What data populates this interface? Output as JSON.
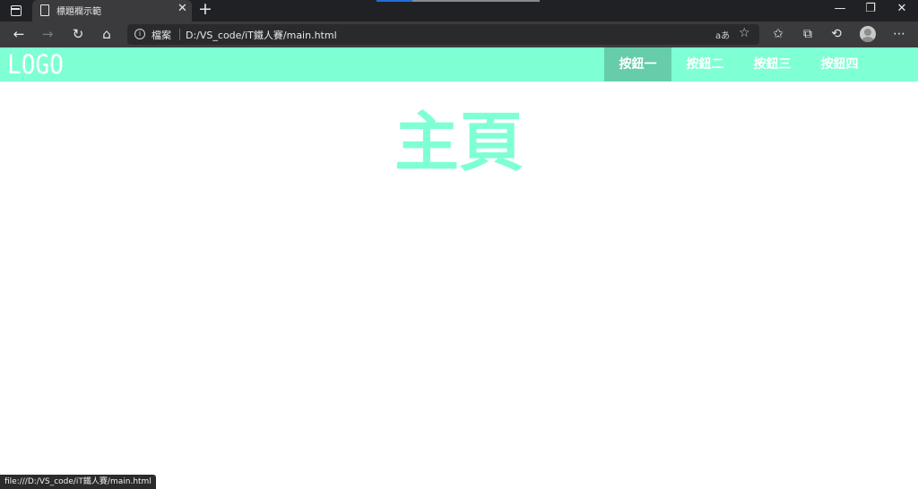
{
  "browser": {
    "tab_title": "標題欄示範",
    "address_label": "檔案",
    "url": "D:/VS_code/iT鐵人賽/main.html",
    "status_url": "file:///D:/VS_code/iT鐵人賽/main.html",
    "icons": {
      "tab_actions": "window-icon",
      "page": "document-icon",
      "close_tab": "close-icon",
      "new_tab": "plus-icon",
      "back": "back-arrow-icon",
      "forward": "forward-arrow-icon",
      "refresh": "refresh-icon",
      "home": "home-icon",
      "site_info": "info-icon",
      "read_aloud": "read-aloud-icon",
      "add_favorite": "add-favorite-icon",
      "favorites": "favorites-icon",
      "collections": "collections-icon",
      "history": "history-icon",
      "profile": "profile-avatar",
      "more": "more-icon"
    }
  },
  "page": {
    "logo": "LOGO",
    "nav_items": [
      {
        "label": "按鈕一",
        "active": true
      },
      {
        "label": "按鈕二",
        "active": false
      },
      {
        "label": "按鈕三",
        "active": false
      },
      {
        "label": "按鈕四",
        "active": false
      }
    ],
    "heading": "主頁"
  },
  "colors": {
    "navbar": "#7fffd4",
    "active_item": "#66ccaa",
    "heading": "#7fffd4",
    "browser_dark": "#202124",
    "browser_toolbar": "#3b3b3d"
  }
}
